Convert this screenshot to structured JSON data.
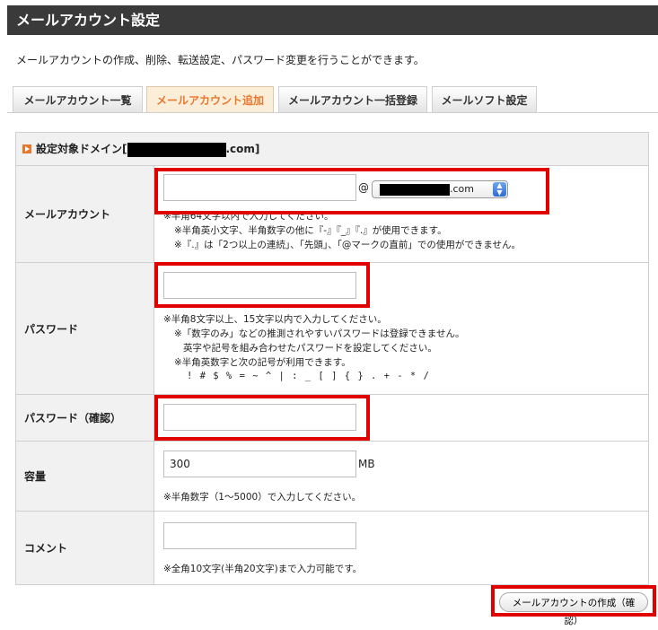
{
  "header": {
    "title": "メールアカウント設定"
  },
  "intro": "メールアカウントの作成、削除、転送設定、パスワード変更を行うことができます。",
  "tabs": [
    {
      "label": "メールアカウント一覧",
      "active": false
    },
    {
      "label": "メールアカウント追加",
      "active": true
    },
    {
      "label": "メールアカウント一括登録",
      "active": false
    },
    {
      "label": "メールソフト設定",
      "active": false
    }
  ],
  "domain": {
    "prefix": "設定対象ドメイン[",
    "suffix": ".com]"
  },
  "form": {
    "account": {
      "label": "メールアカウント",
      "value": "",
      "at": "@",
      "domain_suffix": ".com",
      "notes": [
        "※半角64文字以内で入力してください。",
        "※半角英小文字、半角数字の他に『-』『_』『.』が使用できます。",
        "※『.』は「2つ以上の連続」、「先頭」、「@マークの直前」での使用ができません。"
      ]
    },
    "password": {
      "label": "パスワード",
      "value": "",
      "notes": [
        "※半角8文字以上、15文字以内で入力してください。",
        "※「数字のみ」などの推測されやすいパスワードは登録できません。",
        "英字や記号を組み合わせたパスワードを設定してください。",
        "※半角英数字と次の記号が利用できます。",
        "! # $ % = ~ ^ | : _ [ ] { } . + - * /"
      ]
    },
    "password_confirm": {
      "label": "パスワード（確認）",
      "value": ""
    },
    "capacity": {
      "label": "容量",
      "value": "300",
      "unit": "MB",
      "note": "※半角数字（1〜5000）で入力してください。"
    },
    "comment": {
      "label": "コメント",
      "value": "",
      "note": "※全角10文字(半角20文字)まで入力可能です。"
    }
  },
  "submit_label": "メールアカウントの作成（確認）",
  "colors": {
    "accent": "#e8772e",
    "highlight": "#e00000",
    "header_bg": "#3a3a3a"
  }
}
